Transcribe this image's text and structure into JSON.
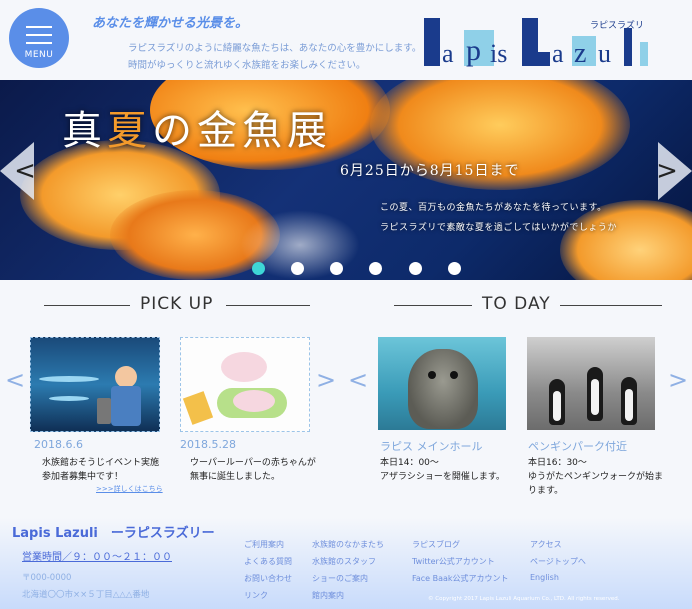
{
  "header": {
    "menu_label": "MENU",
    "tagline": "あなたを輝かせる光景を。",
    "desc_line1": "ラピスラズリのように綺麗な魚たちは、あなたの心を豊かにします。",
    "desc_line2": "時間がゆっくりと流れゆく水族館をお楽しみください。",
    "logo_text": "LapisLazuli",
    "logo_kana": "ラピスラズリ"
  },
  "hero": {
    "title_part1": "真",
    "title_accent": "夏",
    "title_part2": "の金魚展",
    "dates": "6月25日から8月15日まで",
    "copy1": "この夏、百万もの金魚たちがあなたを待っています。",
    "copy2": "ラピスラズリで素敵な夏を過ごしてはいかがでしょうか",
    "prev_glyph": "<",
    "next_glyph": ">",
    "active_slide": 1,
    "slide_count": 6
  },
  "pickup": {
    "heading": "PICK UP",
    "items": [
      {
        "date": "2018.6.6",
        "text_line1": "水族館おそうじイベント実施",
        "text_line2": "参加者募集中です！",
        "more": ">>>詳しくはこちら"
      },
      {
        "date": "2018.5.28",
        "text_line1": "ウーパールーパーの赤ちゃんが",
        "text_line2": "無事に誕生しました。"
      }
    ]
  },
  "today": {
    "heading": "TO DAY",
    "items": [
      {
        "place": "ラピス メインホール",
        "time": "本日14：00～",
        "text_line1": "アザラシショーを開催します。"
      },
      {
        "place": "ペンギンパーク付近",
        "time": "本日16：30～",
        "text_line1": "ゆうがたペンギンウォークが始ま",
        "text_line2": "ります。"
      }
    ]
  },
  "footer": {
    "name": "Lapis Lazuli　ーラピスラズリー",
    "hours": "営業時間／９：００～２１：００",
    "zip": "〒000-0000",
    "address": "北海道〇〇市××５丁目△△△番地",
    "col1": [
      "ご利用案内",
      "よくある質問",
      "お問い合わせ",
      "リンク"
    ],
    "col2": [
      "水族館のなかまたち",
      "水族館のスタッフ",
      "ショーのご案内",
      "館内案内"
    ],
    "col3": [
      "ラピスブログ",
      "Twitter公式アカウント",
      "Face Baak公式アカウント"
    ],
    "col4": [
      "アクセス",
      "ページトップへ",
      "English"
    ],
    "copyright": "© Copyright 2017 Lapis Lazuli Aquarium Co., LTD. All rights reserved."
  },
  "colors": {
    "brand_blue": "#5a8ee8",
    "accent_orange": "#f39a2b",
    "dot_active": "#3ed6d6"
  }
}
